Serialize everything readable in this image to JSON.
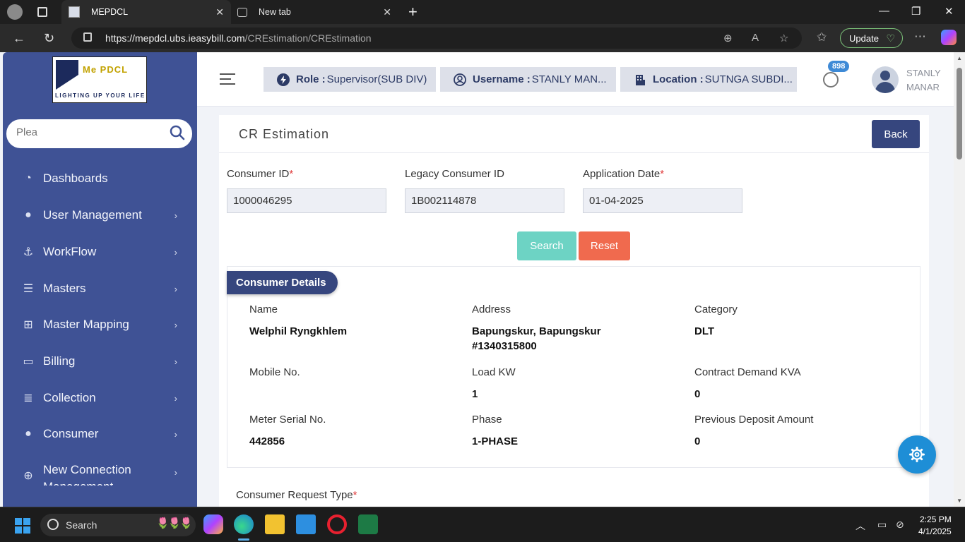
{
  "browser": {
    "tabs": [
      {
        "title": "MEPDCL",
        "active": true
      },
      {
        "title": "New tab",
        "active": false
      }
    ],
    "url_host": "https://mepdcl.ubs.ieasybill.com",
    "url_path": "/CREstimation/CREstimation",
    "update_label": "Update"
  },
  "sidebar": {
    "search_placeholder": "Plea",
    "logo_name": "Me PDCL",
    "logo_tagline": "LIGHTING UP YOUR LIFE",
    "items": [
      {
        "label": "Dashboards",
        "icon": "gauge-icon",
        "has_children": false
      },
      {
        "label": "User Management",
        "icon": "user-icon",
        "has_children": true
      },
      {
        "label": "WorkFlow",
        "icon": "anchor-icon",
        "has_children": true
      },
      {
        "label": "Masters",
        "icon": "server-icon",
        "has_children": true
      },
      {
        "label": "Master Mapping",
        "icon": "sitemap-icon",
        "has_children": true
      },
      {
        "label": "Billing",
        "icon": "monitor-icon",
        "has_children": true
      },
      {
        "label": "Collection",
        "icon": "list-icon",
        "has_children": true
      },
      {
        "label": "Consumer",
        "icon": "user-icon",
        "has_children": true
      },
      {
        "label": "New Connection Management",
        "icon": "plus-circle-icon",
        "has_children": true
      }
    ]
  },
  "topbar": {
    "role_label": "Role :",
    "role_value": "Supervisor(SUB DIV)",
    "username_label": "Username :",
    "username_value": "STANLY MAN...",
    "location_label": "Location :",
    "location_value": "SUTNGA SUBDI...",
    "notification_count": "898",
    "user_first": "STANLY",
    "user_last": "MANAR"
  },
  "page": {
    "title": "CR Estimation",
    "back_label": "Back",
    "fields": {
      "consumer_id_label": "Consumer ID",
      "consumer_id_value": "1000046295",
      "legacy_id_label": "Legacy Consumer ID",
      "legacy_id_value": "1B002114878",
      "app_date_label": "Application Date",
      "app_date_value": "01-04-2025",
      "required_mark": "*"
    },
    "search_label": "Search",
    "reset_label": "Reset",
    "details": {
      "heading": "Consumer Details",
      "name_label": "Name",
      "name_value": "Welphil Ryngkhlem",
      "address_label": "Address",
      "address_line1": "Bapungskur, Bapungskur",
      "address_line2": "#1340315800",
      "category_label": "Category",
      "category_value": "DLT",
      "mobile_label": "Mobile No.",
      "mobile_value": "",
      "load_label": "Load KW",
      "load_value": "1",
      "contract_label": "Contract Demand KVA",
      "contract_value": "0",
      "meter_label": "Meter Serial No.",
      "meter_value": "442856",
      "phase_label": "Phase",
      "phase_value": "1-PHASE",
      "deposit_label": "Previous Deposit Amount",
      "deposit_value": "0"
    },
    "request_type_label": "Consumer Request Type"
  },
  "taskbar": {
    "search_label": "Search",
    "time": "2:25 PM",
    "date": "4/1/2025"
  },
  "colors": {
    "sidebar": "#3f5295",
    "primary": "#36467e",
    "search_btn": "#6dd3c4",
    "reset_btn": "#f06a4e",
    "fab": "#1e8ed6"
  }
}
